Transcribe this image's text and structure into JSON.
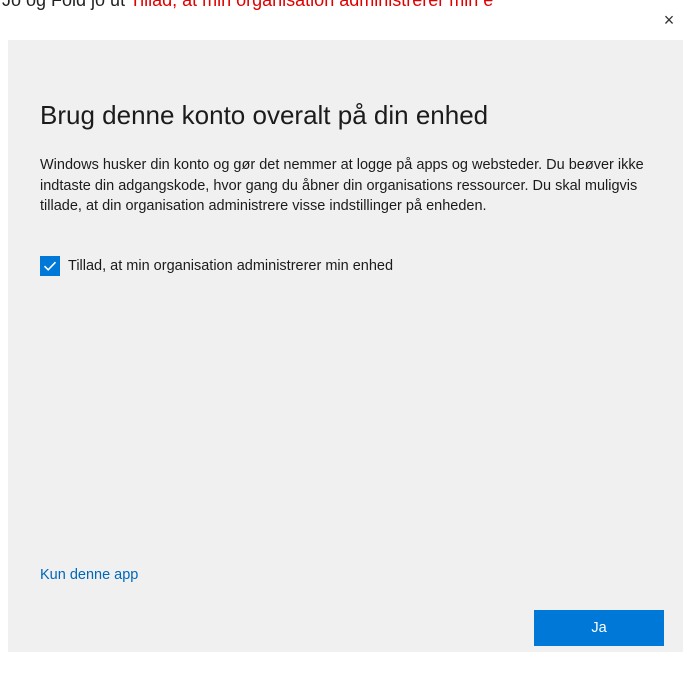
{
  "top_text": {
    "prefix": "Jo og Fold jo ut",
    "red": "Tillad, at min organisation administrerer min e"
  },
  "close_glyph": "×",
  "dialog": {
    "title": "Brug denne konto overalt på din enhed",
    "description": "Windows husker din konto og gør det nemmer at logge på apps og websteder. Du beøver ikke indtaste din adgangskode, hvor gang du åbner din organisations ressourcer. Du skal muligvis tillade, at din organisation administrere visse indstillinger på enheden.",
    "checkbox": {
      "label": "Tillad, at min organisation administrerer min enhed",
      "checked": true
    },
    "link_label": "Kun denne app",
    "primary_button_label": "Ja"
  },
  "colors": {
    "accent": "#0078d7",
    "link": "#0067b8",
    "dialog_bg": "#f0f0f0",
    "warning_text": "#e00000"
  }
}
